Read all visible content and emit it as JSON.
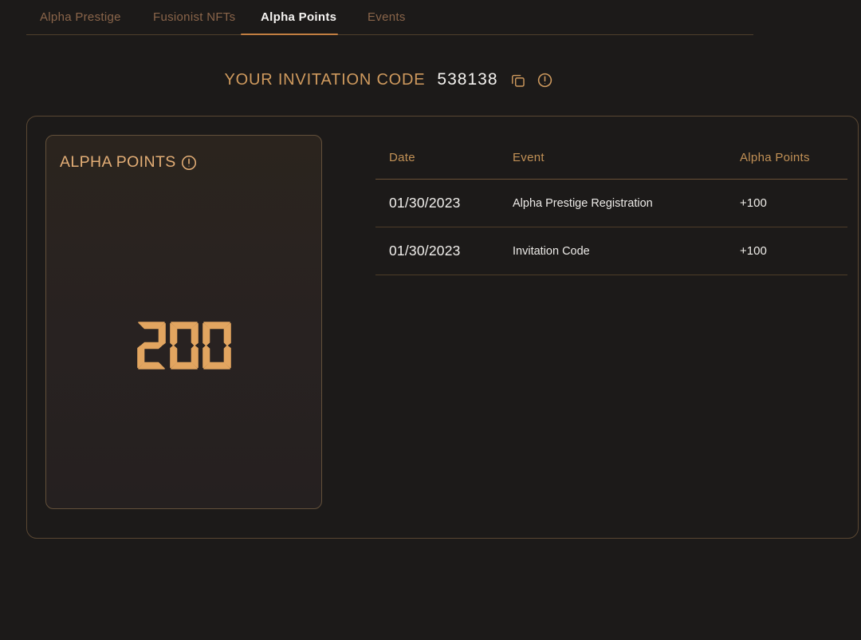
{
  "nav": {
    "tabs": [
      {
        "label": "Alpha Prestige",
        "active": false
      },
      {
        "label": "Fusionist NFTs",
        "active": false
      },
      {
        "label": "Alpha Points",
        "active": true
      },
      {
        "label": "Events",
        "active": false
      }
    ]
  },
  "invitation": {
    "label": "YOUR INVITATION CODE",
    "code": "538138",
    "icons": [
      "copy-icon",
      "info-icon"
    ]
  },
  "card": {
    "title": "ALPHA POINTS",
    "title_icon": "info-icon",
    "points": "200"
  },
  "table": {
    "headers": [
      "Date",
      "Event",
      "Alpha Points"
    ],
    "rows": [
      {
        "date": "01/30/2023",
        "event": "Alpha Prestige Registration",
        "points": "+100"
      },
      {
        "date": "01/30/2023",
        "event": "Invitation Code",
        "points": "+100"
      }
    ]
  },
  "colors": {
    "background": "#1c1a19",
    "accent": "#cf9a5e",
    "accent_bright": "#e2a560",
    "active_tab_indicator": "#c27e41",
    "inactive_tab": "#8a654a",
    "text_white": "#f4f2ef",
    "divider": "#4e3c28"
  }
}
